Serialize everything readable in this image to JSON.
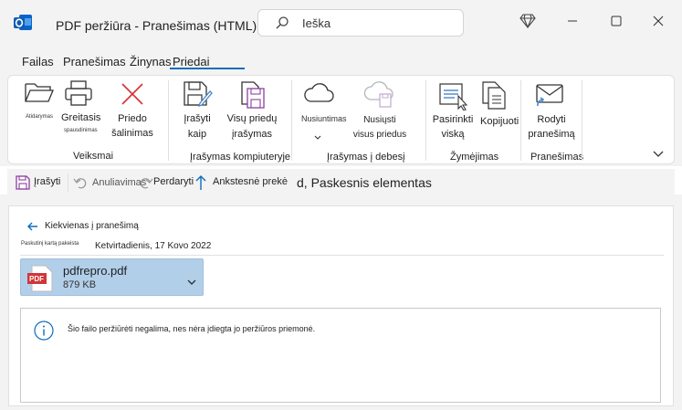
{
  "window": {
    "title": "PDF peržiūra -  Pranešimas (HTML)",
    "search_text": "Ieška"
  },
  "tabs": [
    "Failas",
    "Pranešimas",
    "Žinynas",
    "Priedai"
  ],
  "ribbon": {
    "atidarymas": "Atidarymas",
    "greitasis": "Greitasis",
    "spausdinimas": "spausdinimas",
    "priedo_line1": "Priedo",
    "priedo_line2": "šalinimas",
    "irasyti_kaip_line1": "Įrašyti",
    "irasyti_kaip_line2": "kaip",
    "visu_prieu_line1": "Visų priedų",
    "visu_prieu_line2": "įrašymas",
    "nusiuntimas": "Nusiuntimas",
    "nusiusti_line1": "Nusiųsti",
    "nusiusti_line2": "visus priedus",
    "pasirinkti_line1": "Pasirinkti",
    "pasirinkti_line2": "viską",
    "kopijuoti": "Kopijuoti",
    "rodyti_line1": "Rodyti",
    "rodyti_line2": "pranešimą",
    "groups": {
      "veiksmai": "Veiksmai",
      "irasymas_kompiuteryje": "Įrašymas kompiuteryje",
      "irasymas_i_debesi": "Įrašymas į debesį",
      "zymejimas": "Žymėjimas",
      "pranesimas": "Pranešimas"
    }
  },
  "quickbar": {
    "irasyti": "Įrašyti",
    "anuliavimas": "Anuliavimas",
    "perdaryti": "Perdaryti",
    "ankstesne": "Ankstesnė prekė",
    "paskesnis": "d, Paskesnis elementas"
  },
  "content": {
    "back_link": "Kiekvienas į pranešimą",
    "last_modified_label": "Paskutinį kartą pakeista",
    "last_modified_value": "Ketvirtadienis, 17 Kovo 2022",
    "attachment": {
      "name": "pdfrepro.pdf",
      "size": "879 KB",
      "badge": "PDF"
    },
    "info_message": "Šio failo peržiūrėti negalima, nes nėra įdiegta jo peržiūros priemonė."
  },
  "colors": {
    "accent": "#0f6cbd",
    "attachment_bg": "#b2cfea",
    "pdf_red": "#d13438",
    "save_purple": "#8a3fa0"
  }
}
